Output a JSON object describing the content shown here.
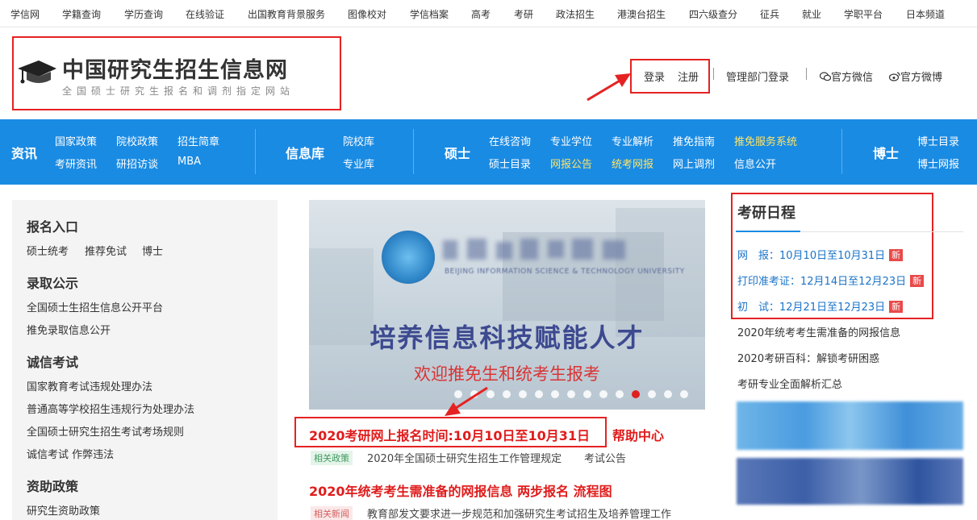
{
  "top_nav": [
    "学信网",
    "学籍查询",
    "学历查询",
    "在线验证",
    "出国教育背景服务",
    "图像校对",
    "学信档案",
    "高考",
    "考研",
    "政法招生",
    "港澳台招生",
    "四六级查分",
    "征兵",
    "就业",
    "学职平台",
    "日本频道"
  ],
  "header": {
    "site_title": "中国研究生招生信息网",
    "site_subtitle": "全国硕士研究生报名和调剂指定网站",
    "login": "登录",
    "register": "注册",
    "admin_login": "管理部门登录",
    "wechat": "官方微信",
    "weibo": "官方微博"
  },
  "main_nav": {
    "news": {
      "label": "资讯",
      "links": [
        "国家政策",
        "院校政策",
        "招生简章",
        "考研资讯",
        "研招访谈",
        "MBA"
      ]
    },
    "database": {
      "label": "信息库",
      "links": [
        "院校库",
        "专业库"
      ]
    },
    "master": {
      "label": "硕士",
      "links": [
        "在线咨询",
        "专业学位",
        "专业解析",
        "推免指南",
        "推免服务系统",
        "硕士目录",
        "网报公告",
        "统考网报",
        "网上调剂",
        "信息公开"
      ]
    },
    "doctor": {
      "label": "博士",
      "links": [
        "博士目录",
        "博士网报"
      ]
    }
  },
  "sidebar": {
    "sections": [
      {
        "title": "报名入口",
        "links": [
          "硕士统考",
          "推荐免试",
          "博士"
        ]
      },
      {
        "title": "录取公示",
        "links": [
          "全国硕士生招生信息公开平台",
          "推免录取信息公开"
        ]
      },
      {
        "title": "诚信考试",
        "links": [
          "国家教育考试违规处理办法",
          "普通高等学校招生违规行为处理办法",
          "全国硕士研究生招生考试考场规则",
          "诚信考试 作弊违法"
        ]
      },
      {
        "title": "资助政策",
        "links": [
          "研究生资助政策"
        ]
      }
    ]
  },
  "banner": {
    "slogan": "培养信息科技赋能人才",
    "welcome": "欢迎推免生和统考生报考",
    "university_en": "BEIJING INFORMATION SCIENCE & TECHNOLOGY UNIVERSITY",
    "slide_count": 15,
    "active_slide": 11
  },
  "news": {
    "headline1": "2020考研网上报名时间:10月10日至10月31日",
    "help_center": "帮助中心",
    "tag1": "相关政策",
    "item1a": "2020年全国硕士研究生招生工作管理规定",
    "item1b": "考试公告",
    "headline2": "2020年统考考生需准备的网报信息 两步报名 流程图",
    "tag2": "相关新闻",
    "item2": "教育部发文要求进一步规范和加强研究生考试招生及培养管理工作"
  },
  "schedule": {
    "title": "考研日程",
    "items": [
      {
        "label": "网　报：10月10日至10月31日",
        "badge": "新"
      },
      {
        "label": "打印准考证：12月14日至12月23日",
        "badge": "新"
      },
      {
        "label": "初　试：12月21日至12月23日",
        "badge": "新"
      }
    ]
  },
  "right_links": [
    "2020年统考考生需准备的网报信息",
    "2020考研百科：解锁考研困惑",
    "考研专业全面解析汇总"
  ],
  "colors": {
    "brand_blue": "#1a8be3",
    "highlight_red": "#e52222",
    "nav_highlight": "#ffe566"
  }
}
